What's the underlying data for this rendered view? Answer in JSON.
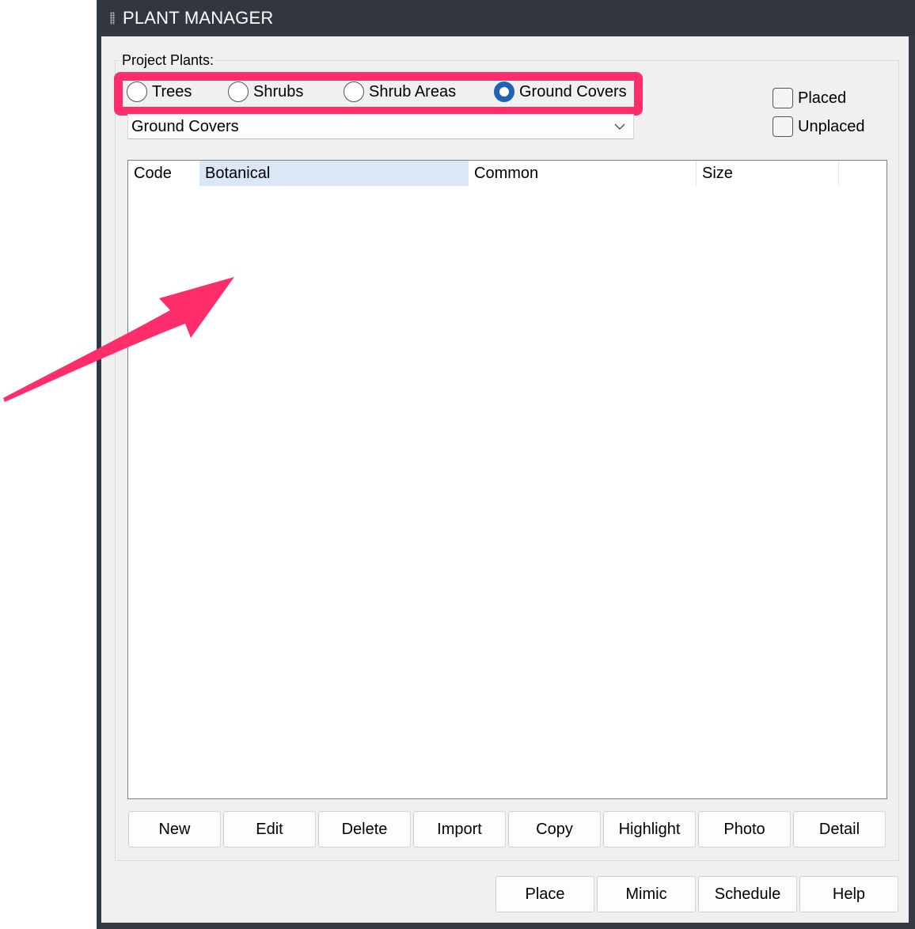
{
  "window": {
    "title": "PLANT MANAGER"
  },
  "project_plants": {
    "label": "Project Plants:",
    "radios": [
      {
        "label": "Trees",
        "checked": false
      },
      {
        "label": "Shrubs",
        "checked": false
      },
      {
        "label": "Shrub Areas",
        "checked": false
      },
      {
        "label": "Ground Covers",
        "checked": true
      }
    ],
    "category_select": {
      "value": "Ground Covers"
    },
    "filters": [
      {
        "label": "Placed",
        "checked": false
      },
      {
        "label": "Unplaced",
        "checked": false
      }
    ]
  },
  "plant_list": {
    "columns": [
      "Code",
      "Botanical",
      "Common",
      "Size"
    ],
    "sorted_column": "Botanical",
    "rows": []
  },
  "list_actions": [
    "New",
    "Edit",
    "Delete",
    "Import",
    "Copy",
    "Highlight",
    "Photo",
    "Detail"
  ],
  "dialog_actions": [
    "Place",
    "Mimic",
    "Schedule",
    "Help"
  ],
  "annotation": {
    "highlight_color": "#ff2e6a",
    "arrow_color": "#ff2e6a"
  },
  "colors": {
    "titlebar": "#323640",
    "radio_checked": "#2062b5",
    "sorted_column": "#dae8f6"
  }
}
